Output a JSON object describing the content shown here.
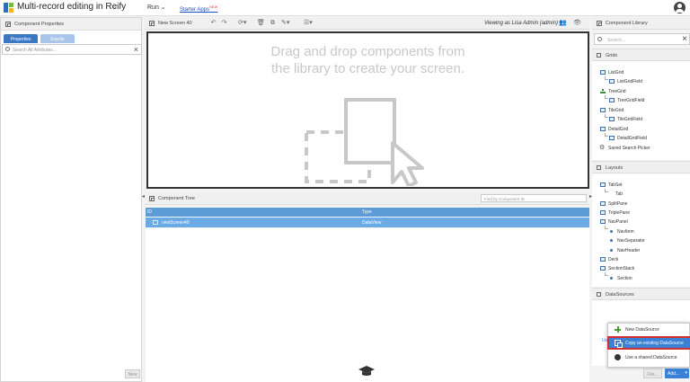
{
  "app": {
    "title": "Multi-record editing in Reify",
    "run_menu": "Run",
    "starter_link": "Starter Apps",
    "starter_badge": "NEW"
  },
  "left_panel": {
    "header": "Component Properties",
    "tabs": [
      "Properties",
      "Events"
    ],
    "search_placeholder": "Search All Attributes...",
    "bottom_button": "New"
  },
  "canvas": {
    "screen_name": "New Screen 40",
    "viewing_as": "Viewing as Lisa Admin (admin)",
    "drop_text_line1": "Drag and drop components from",
    "drop_text_line2": "the library to create your screen."
  },
  "component_tree": {
    "header": "Component Tree",
    "find_placeholder": "Find by Component ID",
    "columns": [
      "ID",
      "Type"
    ],
    "rows": [
      {
        "id": "newScreen40",
        "type": "DataView"
      }
    ]
  },
  "library": {
    "header": "Component Library",
    "search_placeholder": "Search...",
    "sections": [
      {
        "title": "Grids",
        "items": [
          "ListGrid",
          "ListGridField",
          "TreeGrid",
          "TreeGridField",
          "TileGrid",
          "TileGridField",
          "DetailGrid",
          "DetailGridField",
          "Saved Search Picker"
        ]
      },
      {
        "title": "Layouts",
        "items": [
          "TabSet",
          "Tab",
          "SplitPane",
          "TriplePane",
          "NavPanel",
          "NavItem",
          "NavSeparator",
          "NavHeader",
          "Deck",
          "SectionStack",
          "Section"
        ]
      },
      {
        "title": "DataSources",
        "items": []
      }
    ],
    "ds_menu": [
      "New DataSource",
      "Copy an existing DataSource",
      "Use a shared DataSource"
    ],
    "ds_truncated": "Us",
    "file_button": "File...",
    "add_button": "Add..."
  },
  "colors": {
    "accent": "#3a80d4",
    "highlight_border": "#d03030",
    "grid_header": "#5a9bd8"
  }
}
